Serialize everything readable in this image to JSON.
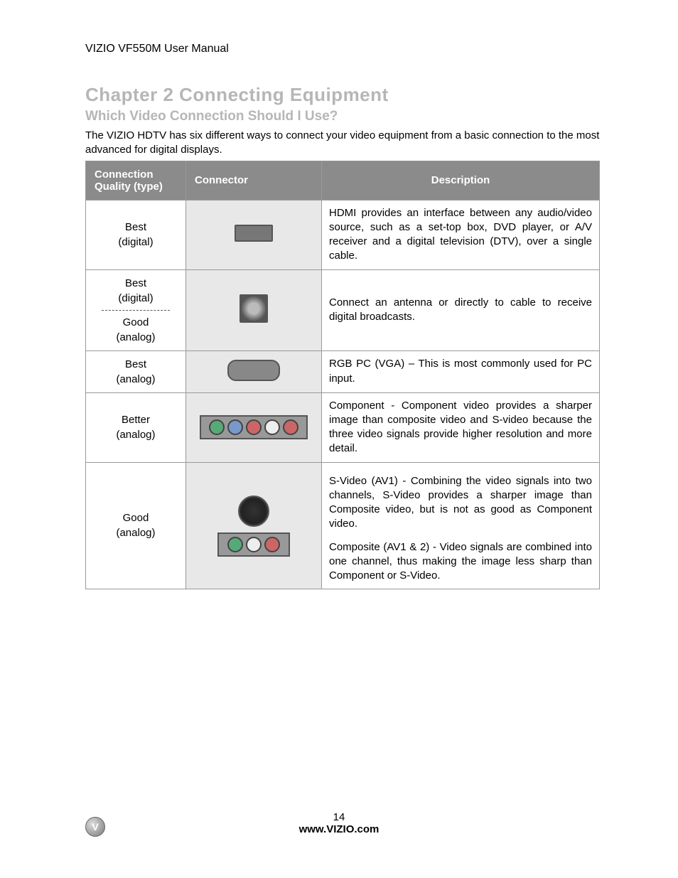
{
  "header": "VIZIO VF550M User Manual",
  "chapter_title": "Chapter 2 Connecting Equipment",
  "subheading": "Which Video Connection Should I Use?",
  "intro": "The VIZIO HDTV has six different ways to connect your video equipment from a basic connection to the most advanced for digital displays.",
  "table": {
    "headers": {
      "quality": "Connection Quality (type)",
      "connector": "Connector",
      "description": "Description"
    },
    "rows": [
      {
        "quality_line1": "Best",
        "quality_line2": "(digital)",
        "description": "HDMI provides an interface between any audio/video source, such as a set-top box, DVD player, or A/V receiver and a digital television (DTV), over a single cable."
      },
      {
        "quality_a_line1": "Best",
        "quality_a_line2": "(digital)",
        "quality_b_line1": "Good",
        "quality_b_line2": "(analog)",
        "description": "Connect an antenna or directly to cable to receive digital broadcasts."
      },
      {
        "quality_line1": "Best",
        "quality_line2": "(analog)",
        "description": "RGB PC (VGA) – This is most commonly used for PC input."
      },
      {
        "quality_line1": "Better",
        "quality_line2": "(analog)",
        "description": "Component - Component video provides a sharper image than composite video and S-video because the three video signals provide higher resolution and more detail."
      },
      {
        "quality_line1": "Good",
        "quality_line2": "(analog)",
        "desc_p1": "S-Video (AV1) - Combining the video signals into two channels, S-Video provides a sharper image than Composite video, but is not as good as Component video.",
        "desc_p2": "Composite (AV1 & 2) - Video signals are combined into one channel, thus making the image less sharp than Component or S-Video."
      }
    ]
  },
  "footer": {
    "page_number": "14",
    "url": "www.VIZIO.com"
  }
}
